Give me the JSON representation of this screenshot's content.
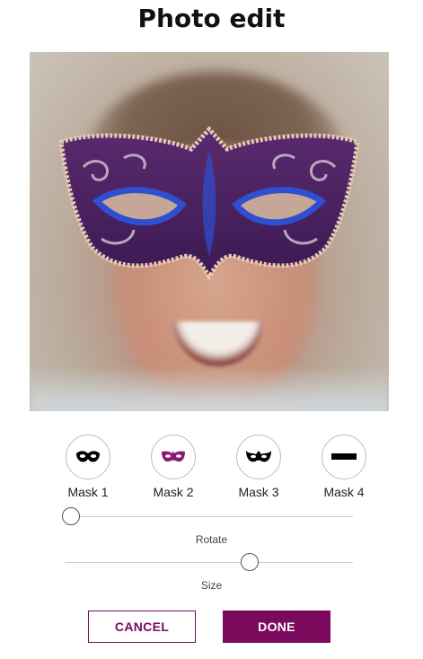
{
  "page": {
    "title": "Photo edit"
  },
  "masks": [
    {
      "label": "Mask 1",
      "icon": "eye-mask-icon",
      "color": "#000000"
    },
    {
      "label": "Mask 2",
      "icon": "venetian-mask-icon",
      "color": "#8a1a6f"
    },
    {
      "label": "Mask 3",
      "icon": "ornate-mask-icon",
      "color": "#000000"
    },
    {
      "label": "Mask 4",
      "icon": "censor-bar-icon",
      "color": "#000000"
    }
  ],
  "sliders": {
    "rotate": {
      "label": "Rotate",
      "value": 0.02
    },
    "size": {
      "label": "Size",
      "value": 0.64
    }
  },
  "buttons": {
    "cancel": "CANCEL",
    "done": "DONE"
  },
  "colors": {
    "accent": "#7b0a5c"
  }
}
